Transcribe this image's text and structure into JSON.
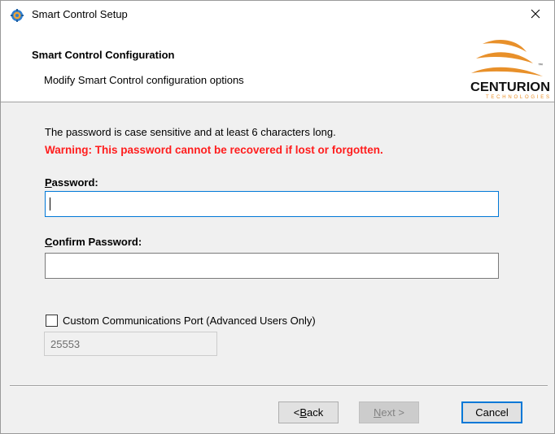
{
  "window": {
    "title": "Smart Control Setup",
    "close_glyph": "✕",
    "app_icon": "setup-gear-icon"
  },
  "banner": {
    "title": "Smart Control Configuration",
    "subtitle": "Modify Smart Control configuration options",
    "logo": {
      "wordmark": "CENTURION",
      "tagline": "TECHNOLOGIES",
      "tm": "™"
    }
  },
  "content": {
    "info": "The password is case sensitive and at least 6 characters long.",
    "warning": "Warning: This password cannot be recovered if lost or forgotten.",
    "password": {
      "label_mnemonic": "P",
      "label_rest": "assword:",
      "value": ""
    },
    "confirm_password": {
      "label_mnemonic": "C",
      "label_rest": "onfirm Password:",
      "value": ""
    },
    "custom_port": {
      "checked": false,
      "label": "Custom Communications Port (Advanced Users Only)",
      "value": "25553",
      "enabled": false
    }
  },
  "buttons": {
    "back": {
      "prefix": "< ",
      "mnemonic": "B",
      "rest": "ack",
      "enabled": true
    },
    "next": {
      "mnemonic": "N",
      "rest": "ext >",
      "enabled": false
    },
    "cancel": {
      "label": "Cancel",
      "enabled": true,
      "default": true
    }
  },
  "colors": {
    "warning": "#ff1d1d",
    "focus": "#0078d7",
    "logo_orange": "#e8902a",
    "dialog_bg": "#f0f0f0"
  }
}
